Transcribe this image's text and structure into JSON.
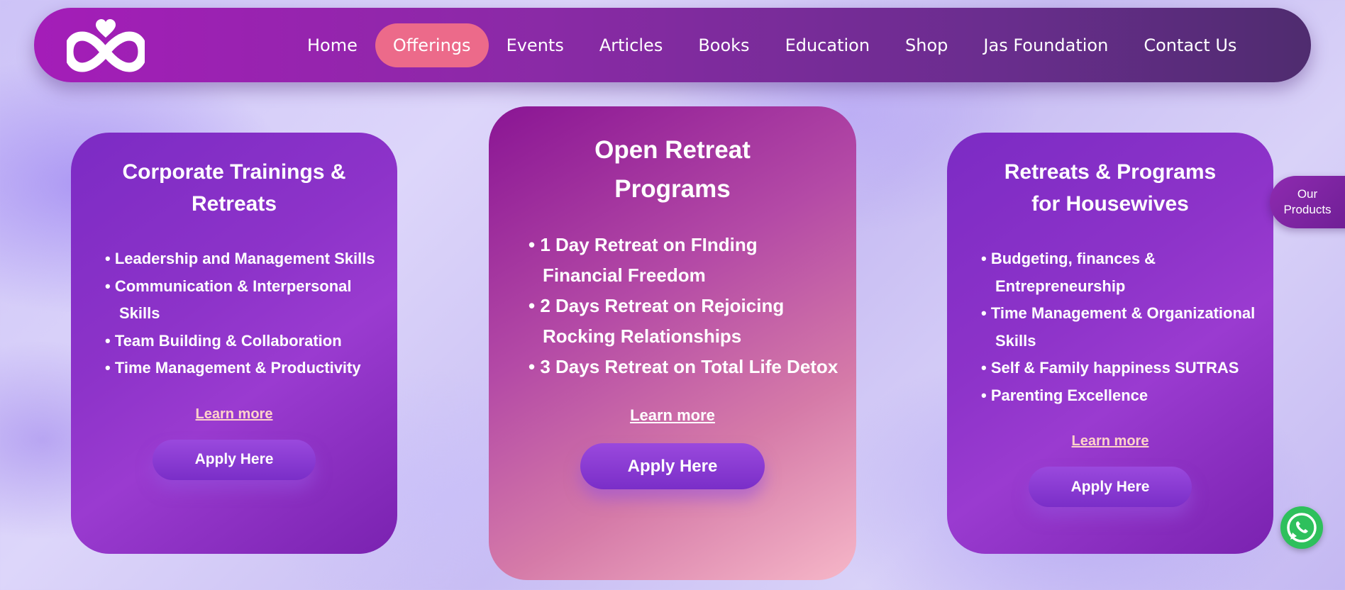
{
  "nav": {
    "items": [
      "Home",
      "Offerings",
      "Events",
      "Articles",
      "Books",
      "Education",
      "Shop",
      "Jas Foundation",
      "Contact Us"
    ],
    "active": "Offerings"
  },
  "cards": {
    "left": {
      "title_line1": "Corporate Trainings &",
      "title_line2": "Retreats",
      "items": [
        "Leadership and Management Skills",
        "Communication & Interpersonal Skills",
        "Team Building & Collaboration",
        "Time Management & Productivity"
      ],
      "learn_more": "Learn more",
      "apply": "Apply Here"
    },
    "center": {
      "title_line1": "Open Retreat",
      "title_line2": "Programs",
      "items": [
        "1 Day Retreat on FInding Financial Freedom",
        "2 Days Retreat on Rejoicing Rocking Relationships",
        "3 Days Retreat on Total Life Detox"
      ],
      "learn_more": "Learn more",
      "apply": "Apply Here"
    },
    "right": {
      "title_line1": "Retreats & Programs",
      "title_line2": "for Housewives",
      "items": [
        "Budgeting, finances & Entrepreneurship",
        "Time Management & Organizational Skills",
        "Self & Family happiness SUTRAS",
        "Parenting Excellence"
      ],
      "learn_more": "Learn more",
      "apply": "Apply Here"
    }
  },
  "products_tab": {
    "line1": "Our",
    "line2": "Products"
  },
  "icons": {
    "logo": "infinity-heart-logo",
    "chat": "whatsapp-icon"
  },
  "colors": {
    "nav_active": "#ec6a8a",
    "whatsapp": "#2ec05c",
    "link_side": "#ffd3c9"
  }
}
